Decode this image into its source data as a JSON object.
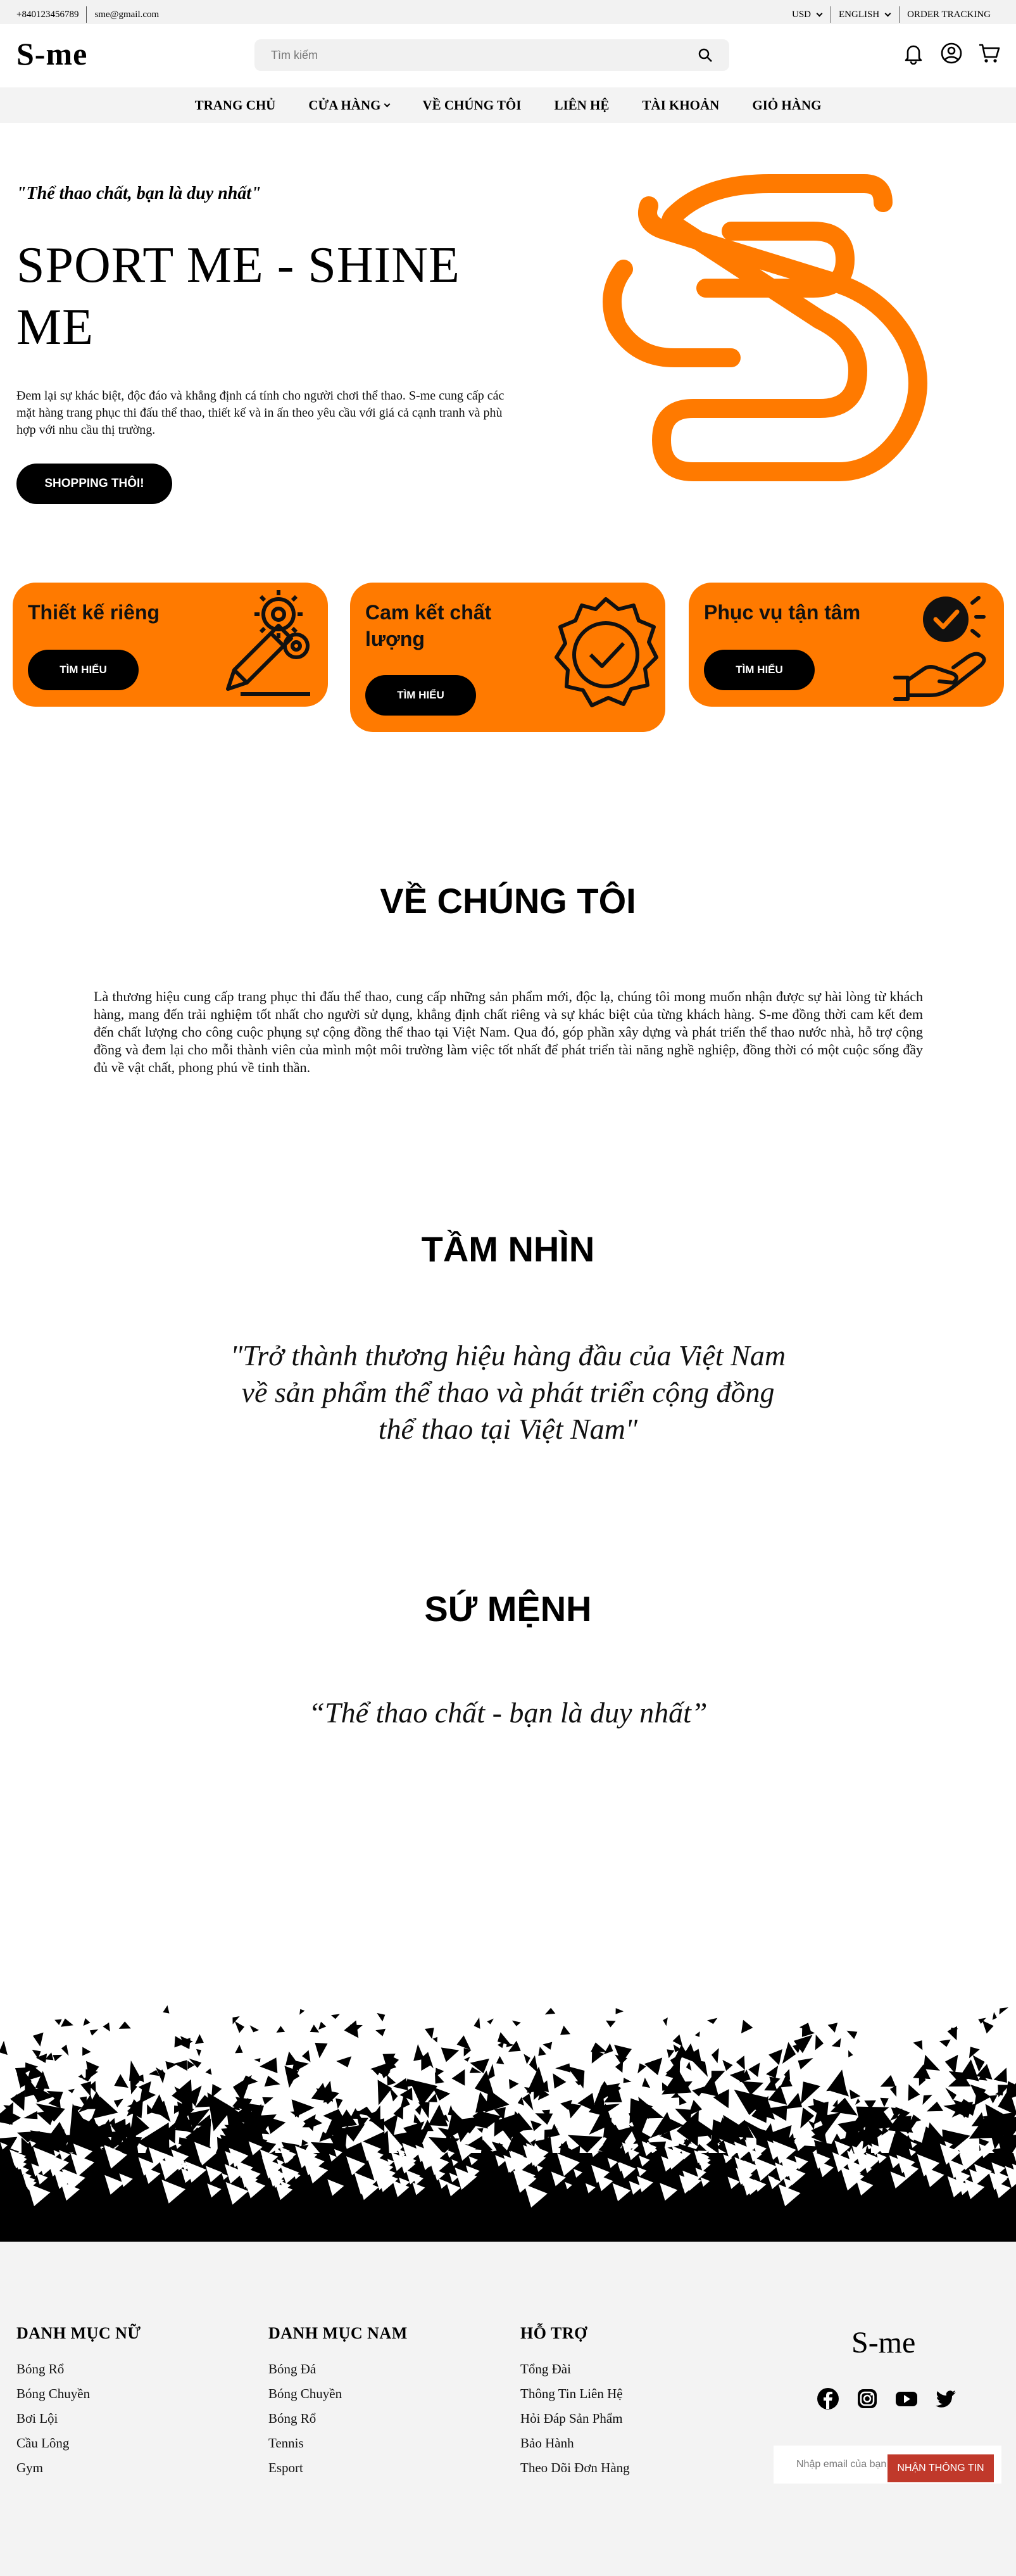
{
  "topbar": {
    "phone": "+840123456789",
    "email": "sme@gmail.com",
    "currency": "USD",
    "language": "ENGLISH",
    "order_tracking": "ORDER TRACKING"
  },
  "header": {
    "logo": "S-me",
    "search_placeholder": "Tìm kiếm"
  },
  "nav": {
    "items": [
      "TRANG CHỦ",
      "CỬA HÀNG",
      "VỀ CHÚNG TÔI",
      "LIÊN HỆ",
      "TÀI KHOẢN",
      "GIỎ HÀNG"
    ]
  },
  "hero": {
    "quote": "\"Thể thao chất, bạn là duy nhất\"",
    "title": "SPORT ME - SHINE ME",
    "description": "Đem lại sự khác biệt, độc đáo và khẳng định cá tính cho người chơi thể thao. S-me cung cấp các mặt hàng trang phục thi đấu thể thao, thiết kế và in ấn theo yêu cầu với giá cả cạnh tranh và phù hợp với nhu cầu thị trường.",
    "button": "SHOPPING THÔI!",
    "accent_color": "#ff7a00"
  },
  "cards": [
    {
      "title": "Thiết kế riêng",
      "button": "TÌM HIỂU",
      "icon": "pencil-gears-icon"
    },
    {
      "title": "Cam kết chất lượng",
      "button": "TÌM HIỂU",
      "icon": "quality-badge-icon"
    },
    {
      "title": "Phục vụ tận tâm",
      "button": "TÌM HIỂU",
      "icon": "hand-check-icon"
    }
  ],
  "about": {
    "title": "VỀ CHÚNG TÔI",
    "text": "Là thương hiệu cung cấp trang phục thi đấu thể thao, cung cấp những sản phẩm mới, độc lạ, chúng tôi mong muốn nhận được sự hài lòng từ khách hàng, mang đến trải nghiệm tốt nhất cho người sử dụng, khẳng định chất riêng và sự khác biệt của từng khách hàng. S-me đồng thời cam kết đem đến chất lượng cho công cuộc phụng sự cộng đồng thể thao tại Việt Nam. Qua đó, góp phần xây dựng và phát triển thể thao nước nhà, hỗ trợ cộng đồng và đem lại cho mỗi thành viên của mình một môi trường làm việc tốt nhất để phát triển tài năng nghề nghiệp, đồng thời có một cuộc sống đầy đủ về vật chất, phong phú về tinh thần."
  },
  "vision": {
    "title": "TẦM NHÌN",
    "lines": [
      "\"Trở thành thương hiệu hàng đầu của Việt Nam",
      "về sản phẩm thể thao và phát triển cộng đồng",
      "thể thao tại Việt Nam\""
    ]
  },
  "mission": {
    "title": "SỨ MỆNH",
    "quote": "“Thể thao chất - bạn là duy nhất”"
  },
  "footer": {
    "women": {
      "title": "DANH MỤC NỮ",
      "links": [
        "Bóng Rổ",
        "Bóng Chuyền",
        "Bơi Lội",
        "Cầu Lông",
        "Gym"
      ]
    },
    "men": {
      "title": "DANH MỤC NAM",
      "links": [
        "Bóng Đá",
        "Bóng Chuyền",
        "Bóng Rổ",
        "Tennis",
        "Esport"
      ]
    },
    "support": {
      "title": "HỖ TRỢ",
      "links": [
        "Tổng Đài",
        "Thông Tin Liên Hệ",
        "Hỏi Đáp Sản Phẩm",
        "Bảo Hành",
        "Theo Dõi Đơn Hàng"
      ]
    },
    "logo": "S-me",
    "social_icons": [
      "facebook-icon",
      "instagram-icon",
      "youtube-icon",
      "twitter-icon"
    ],
    "email_placeholder": "Nhập email của bạn",
    "subscribe_button": "NHẬN THÔNG TIN"
  }
}
